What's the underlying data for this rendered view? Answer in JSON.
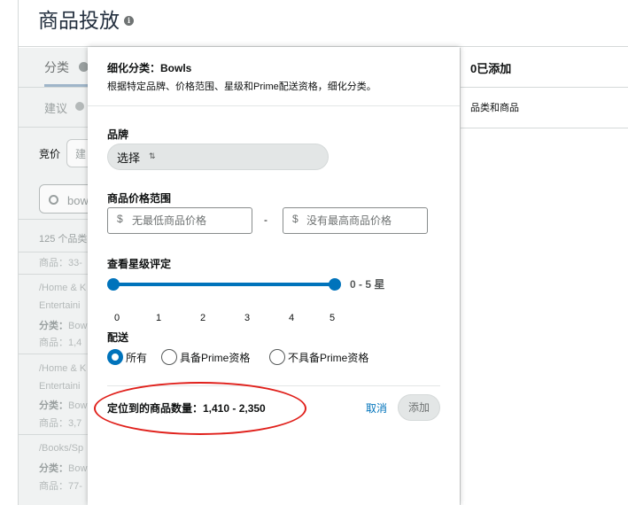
{
  "page": {
    "title": "商品投放"
  },
  "left_panel": {
    "tab_category": "分类",
    "tab_suggest": "建议",
    "bid_label": "竞价",
    "bid_placeholder": "建",
    "search_value": "bow",
    "result_count": "125 个品类",
    "items": [
      {
        "line1": "商品：33-",
        "line2": "",
        "line3": ""
      },
      {
        "line1": "/Home & K",
        "line2": "Entertaini",
        "line3_label": "分类：",
        "line3": "Bow",
        "line4": "商品：1,4"
      },
      {
        "line1": "/Home & K",
        "line2": "Entertaini",
        "line3_label": "分类：",
        "line3": "Bow",
        "line4": "商品：3,7"
      },
      {
        "line1": "/Books/Sp",
        "line3_label": "分类：",
        "line3": "Bow",
        "line4": "商品：77-"
      }
    ]
  },
  "right_panel": {
    "added_title": "0已添加",
    "subtitle": "品类和商品"
  },
  "modal": {
    "title": "细化分类：Bowls",
    "description": "根据特定品牌、价格范围、星级和Prime配送资格，细化分类。",
    "brand": {
      "label": "品牌",
      "select_text": "选择",
      "sort_icon": "⇅"
    },
    "price": {
      "label": "商品价格范围",
      "currency": "$",
      "min_placeholder": "无最低商品价格",
      "dash": "-",
      "max_placeholder": "没有最高商品价格"
    },
    "rating": {
      "label": "查看星级评定",
      "range_text": "0 - 5 星",
      "min": 0,
      "max": 5,
      "ticks": [
        "0",
        "1",
        "2",
        "3",
        "4",
        "5"
      ]
    },
    "shipping": {
      "label": "配送",
      "options": [
        "所有",
        "具备Prime资格",
        "不具备Prime资格"
      ],
      "selected": "所有"
    },
    "result_text": "定位到的商品数量：1,410 - 2,350",
    "cancel_label": "取消",
    "add_label": "添加"
  },
  "colors": {
    "accent": "#0073bb",
    "annotation": "#e0201b"
  }
}
